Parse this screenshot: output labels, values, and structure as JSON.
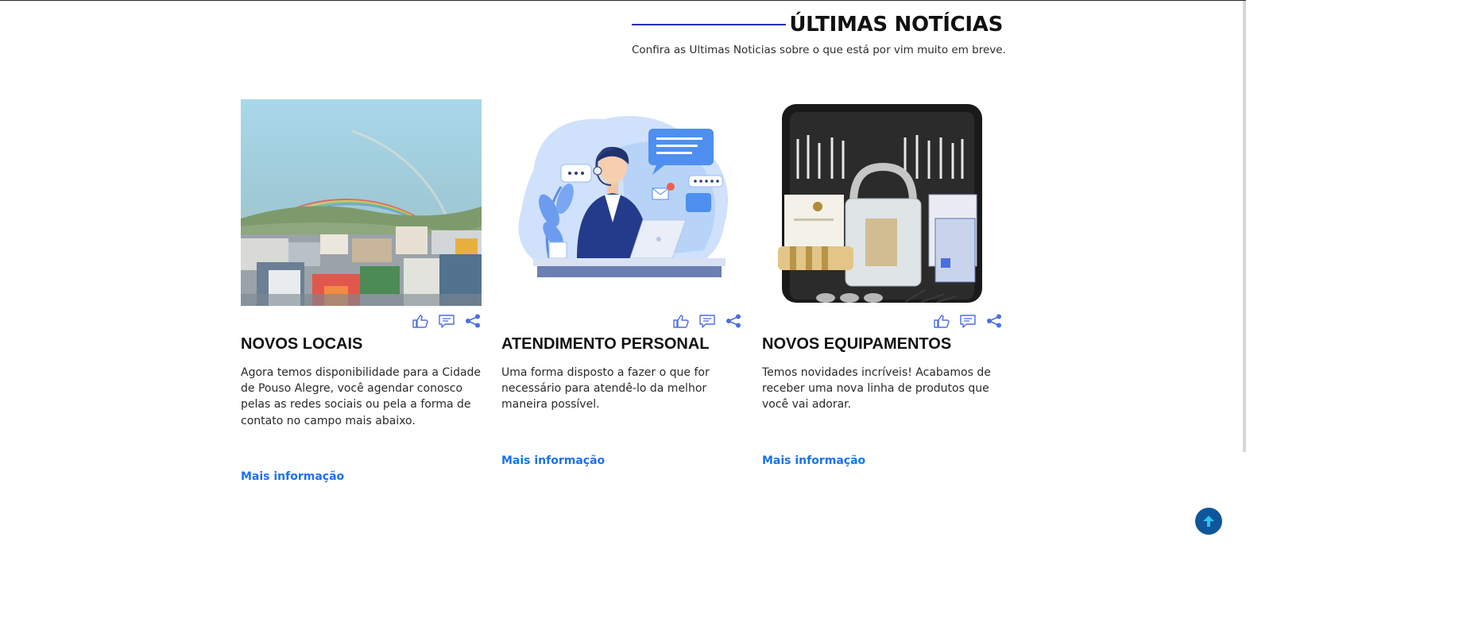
{
  "colors": {
    "accent_blue": "#1a73e8",
    "title_line": "#1f2fb8",
    "icon_blue": "#4c6ee0",
    "scroll_button": "#10569a"
  },
  "section": {
    "title": "ÚLTIMAS NOTÍCIAS",
    "subtitle": "Confira as Ultimas Noticias sobre o que está por vim muito em breve."
  },
  "cards": [
    {
      "image": "rainbow-city-photo",
      "title": "NOVOS LOCAIS",
      "text": "Agora temos disponibilidade para a Cidade de Pouso Alegre, você agendar conosco pelas as redes sociais ou pela a forma de contato no campo mais abaixo.",
      "link": "Mais informação"
    },
    {
      "image": "customer-support-illustration",
      "title": "ATENDIMENTO PERSONAL",
      "text": "Uma forma disposto a fazer o que for necessário para atendê-lo da melhor maneira possível.",
      "link": "Mais informação"
    },
    {
      "image": "lockpick-set-photo",
      "title": "NOVOS EQUIPAMENTOS",
      "text": "Temos novidades incríveis! Acabamos de receber uma nova linha de produtos que você vai adorar.",
      "link": "Mais informação"
    }
  ],
  "icons": {
    "like": "thumbs-up-icon",
    "comment": "comment-icon",
    "share": "share-icon",
    "scroll_top": "arrow-up-icon"
  }
}
